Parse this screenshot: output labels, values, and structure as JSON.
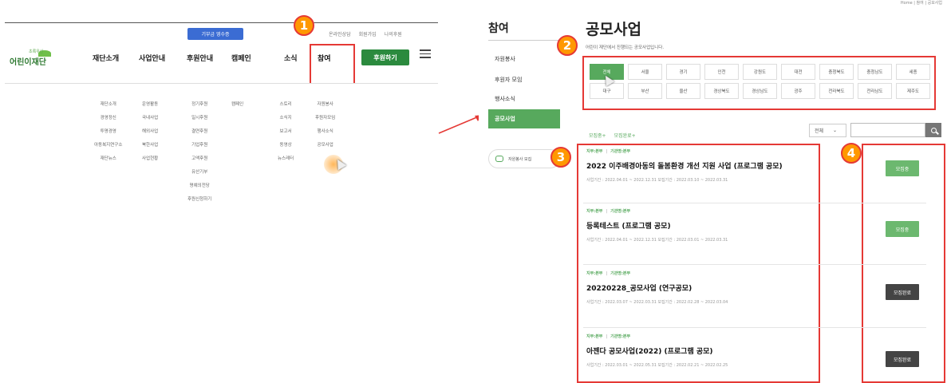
{
  "callouts": [
    "1",
    "2",
    "3",
    "4"
  ],
  "left": {
    "receipt_button": "기부금 영수증",
    "util_links": [
      "온라인상담",
      "회원가입",
      "나의후원"
    ],
    "logo_tag": "초록우산",
    "logo_name": "어린이재단",
    "gnb": [
      "재단소개",
      "사업안내",
      "후원안내",
      "캠페인",
      "소식",
      "참여"
    ],
    "donate_button": "후원하기",
    "submenus": {
      "about": [
        "재단소개",
        "경영정신",
        "투명경영",
        "아동복지연구소",
        "재단뉴스"
      ],
      "business": [
        "운영활동",
        "국내사업",
        "해외사업",
        "북한사업",
        "사업현황"
      ],
      "support": [
        "정기후원",
        "일시후원",
        "결연후원",
        "기업후원",
        "고액후원",
        "유산기부",
        "명예의전당",
        "후원신청하기"
      ],
      "campaign": [
        "캠페인"
      ],
      "news": [
        "스토리",
        "소식지",
        "보고서",
        "동영상",
        "뉴스레터"
      ],
      "participate": [
        "자원봉사",
        "후원자모임",
        "행사소식",
        "공모사업"
      ]
    }
  },
  "right": {
    "breadcrumb": "Home  |  참여  |  공모사업",
    "side_title": "참여",
    "side_items": [
      "자원봉사",
      "후원자 모임",
      "행사소식",
      "공모사업"
    ],
    "side_banner": "자원봉사 모집",
    "page_title": "공모사업",
    "page_desc": "어린이 재단에서 진행되는 공모사업입니다.",
    "regions": [
      "전체",
      "서울",
      "경기",
      "인천",
      "강원도",
      "대전",
      "충청북도",
      "충청남도",
      "세종",
      "대구",
      "부산",
      "울산",
      "경상북도",
      "경상남도",
      "광주",
      "전라북도",
      "전라남도",
      "제주도"
    ],
    "filter_links": [
      "모집중+",
      "모집완료+"
    ],
    "select_value": "전체",
    "items": [
      {
        "meta_a": "지부:본부",
        "meta_b": "기관명:본부",
        "title": "2022 이주배경아동의 돌봄환경 개선 지원 사업 (프로그램 공모)",
        "period": "사업기간 : 2022.04.01 ~ 2022.12.31      모집기간 : 2022.03.10 ~ 2022.03.31",
        "status": "모집중"
      },
      {
        "meta_a": "지부:본부",
        "meta_b": "기관명:본부",
        "title": "등록테스트 (프로그램 공모)",
        "period": "사업기간 : 2022.04.01 ~ 2022.12.31      모집기간 : 2022.03.01 ~ 2022.03.31",
        "status": "모집중"
      },
      {
        "meta_a": "지부:본부",
        "meta_b": "기관명:본부",
        "title": "20220228_공모사업 (연구공모)",
        "period": "사업기간 : 2022.03.07 ~ 2022.03.31      모집기간 : 2022.02.28 ~ 2022.03.04",
        "status": "모집완료"
      },
      {
        "meta_a": "지부:본부",
        "meta_b": "기관명:본부",
        "title": "아젠다 공모사업(2022) (프로그램 공모)",
        "period": "사업기간 : 2022.03.01 ~ 2022.05.31      모집기간 : 2022.02.21 ~ 2022.02.25",
        "status": "모집완료"
      }
    ]
  },
  "colors": {
    "accent": "#57a95d",
    "highlight": "#e53935",
    "badge": "#ff9800",
    "closed": "#444444"
  }
}
